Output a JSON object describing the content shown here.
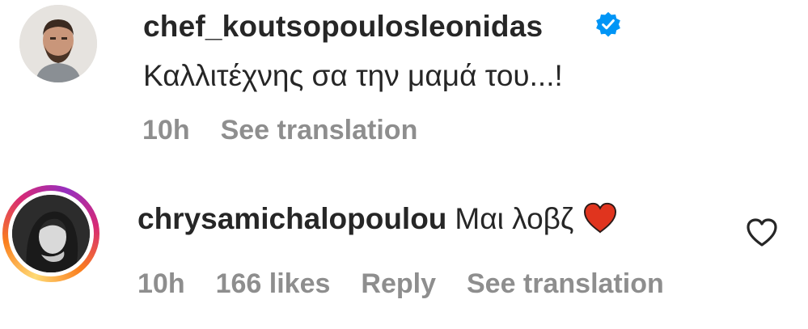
{
  "comments": [
    {
      "username": "chef_koutsopoulosleonidas",
      "verified": true,
      "text": "Καλλιτέχνης σα την μαμά του...!",
      "time": "10h",
      "see_translation": "See translation"
    },
    {
      "username": "chrysamichalopoulou",
      "text": "Μαι λοβζ",
      "emoji": "red-heart-icon",
      "time": "10h",
      "likes": "166 likes",
      "reply": "Reply",
      "see_translation": "See translation",
      "has_story_ring": true
    }
  ],
  "colors": {
    "text": "#262626",
    "meta": "#8e8e8e",
    "verified": "#0095f6",
    "heart": "#ed4956"
  }
}
